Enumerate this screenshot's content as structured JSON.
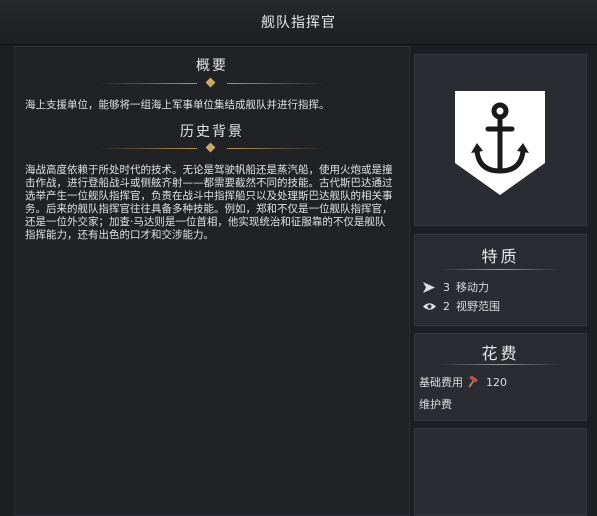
{
  "header": {
    "title": "舰队指挥官"
  },
  "overview": {
    "heading": "概要",
    "text": "海上支援单位，能够将一组海上军事单位集结成舰队并进行指挥。"
  },
  "history": {
    "heading": "历史背景",
    "text": "海战高度依赖于所处时代的技术。无论是驾驶帆船还是蒸汽船，使用火炮或是撞击作战，进行登船战斗或侧舷齐射——都需要截然不同的技能。古代斯巴达通过选举产生一位舰队指挥官，负责在战斗中指挥船只以及处理斯巴达舰队的相关事务。后来的舰队指挥官往往具备多种技能。例如，郑和不仅是一位舰队指挥官，还是一位外交家；加查·马达则是一位首相，他实现统治和征服靠的不仅是舰队指挥能力，还有出色的口才和交涉能力。"
  },
  "emblem": {
    "icon": "anchor-icon",
    "shield_color": "#ffffff",
    "anchor_color": "#1a1a1a"
  },
  "traits": {
    "heading": "特质",
    "items": [
      {
        "icon": "movement-arrow-icon",
        "value": "3",
        "label": "移动力"
      },
      {
        "icon": "eye-icon",
        "value": "2",
        "label": "视野范围"
      }
    ]
  },
  "cost": {
    "heading": "花费",
    "base_label": "基础费用",
    "base_icon": "hammer-icon",
    "base_value": "120",
    "upkeep_label": "维护费"
  },
  "colors": {
    "accent_gold": "#c9a766",
    "panel": "#202226",
    "card": "#2a2c31"
  }
}
